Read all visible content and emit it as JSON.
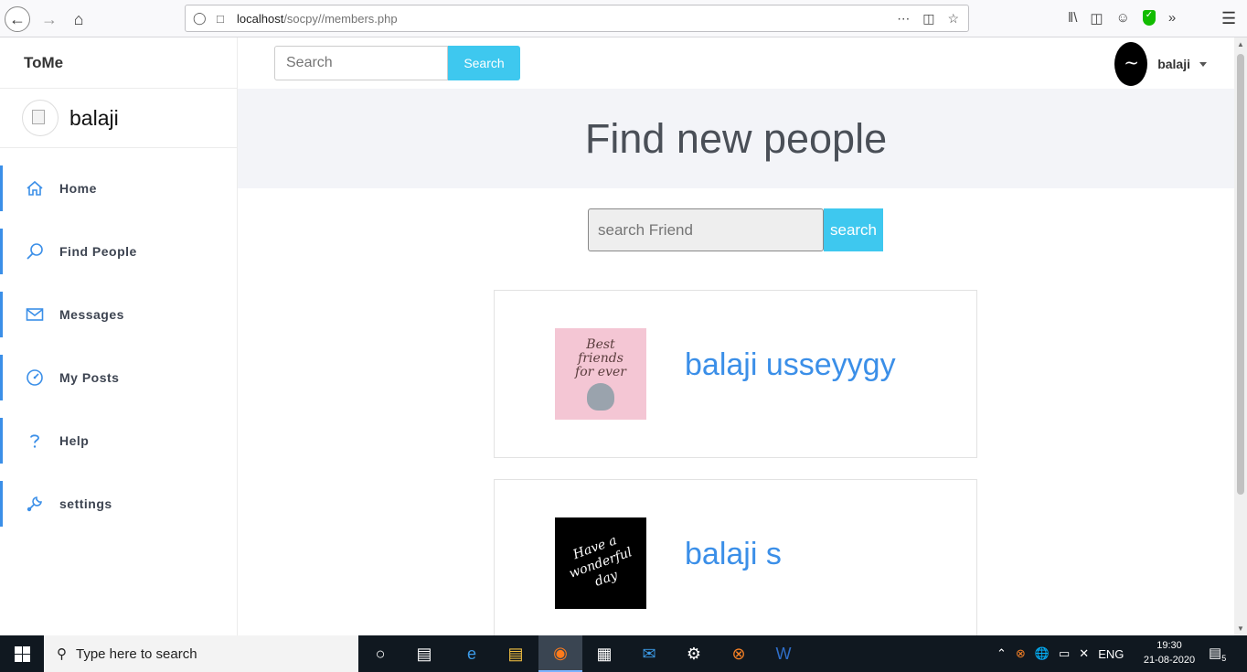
{
  "browser": {
    "url_host": "localhost",
    "url_path": "/socpy//members.php"
  },
  "app": {
    "brand": "ToMe",
    "sidebar_user": "balaji",
    "menu": [
      {
        "label": "Home",
        "icon": "home-icon"
      },
      {
        "label": "Find People",
        "icon": "search-icon"
      },
      {
        "label": "Messages",
        "icon": "mail-icon"
      },
      {
        "label": "My Posts",
        "icon": "gauge-icon"
      },
      {
        "label": "Help",
        "icon": "question-icon"
      },
      {
        "label": "settings",
        "icon": "wrench-icon"
      }
    ],
    "accent": "#3b8fe8",
    "button_color": "#3ec8ef"
  },
  "topbar": {
    "search_placeholder": "Search",
    "search_button": "Search",
    "user_name": "balaji"
  },
  "main": {
    "title": "Find new people",
    "find_placeholder": "search Friend",
    "find_button": "search",
    "people": [
      {
        "name": "balaji usseyygy",
        "pic_text": "Best friends for ever"
      },
      {
        "name": "balaji s",
        "pic_text": "Have a wonderful day"
      }
    ]
  },
  "taskbar": {
    "search_text": "Type here to search",
    "language": "ENG",
    "time": "19:30",
    "date": "21-08-2020",
    "notification_count": "5"
  }
}
